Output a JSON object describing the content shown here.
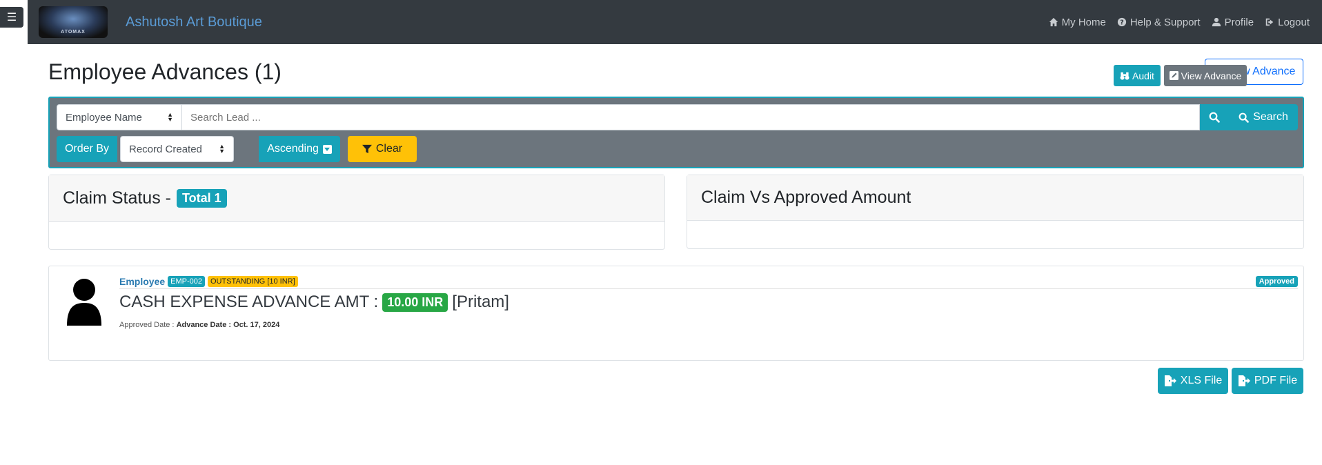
{
  "app": {
    "brand": "Ashutosh Art Boutique",
    "logo_text": "ATOMAX"
  },
  "nav": {
    "home": "My Home",
    "help": "Help & Support",
    "profile": "Profile",
    "logout": "Logout"
  },
  "page": {
    "title": "Employee Advances (1)",
    "new_button": "New Advance"
  },
  "search": {
    "field_selected": "Employee Name",
    "placeholder": "Search Lead ...",
    "search_label": "Search",
    "order_by_label": "Order By",
    "order_selected": "Record Created",
    "direction_label": "Ascending",
    "clear_label": "Clear"
  },
  "cards": {
    "claim_status_title": "Claim Status -",
    "claim_status_total": "Total 1",
    "claim_vs_title": "Claim Vs Approved Amount"
  },
  "advance": {
    "employee_label": "Employee",
    "emp_code": "EMP-002",
    "outstanding": "OUTSTANDING [10 INR]",
    "status": "Approved",
    "title": "CASH EXPENSE ADVANCE AMT :",
    "amount": "10.00 INR",
    "person": "[Pritam]",
    "approved_label": "Approved Date :",
    "advance_date": "Advance Date : Oct. 17, 2024",
    "audit_label": "Audit",
    "view_label": "View Advance"
  },
  "export": {
    "xls_label": "XLS File",
    "pdf_label": "PDF File"
  },
  "colors": {
    "navbar": "#343a40",
    "info": "#17a2b8",
    "warning": "#ffc107",
    "success": "#28a745",
    "secondary": "#6c757d",
    "primary": "#0d6efd"
  }
}
